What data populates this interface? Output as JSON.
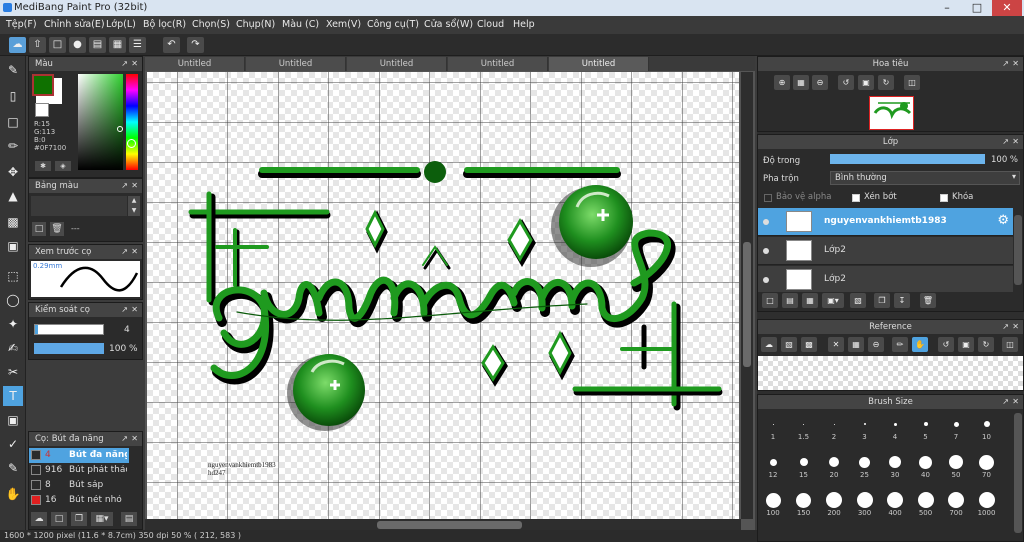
{
  "app": {
    "title": "MediBang Paint Pro (32bit)"
  },
  "menu": [
    "Tệp(F)",
    "Chỉnh sửa(E)",
    "Lớp(L)",
    "Bộ lọc(R)",
    "Chọn(S)",
    "Chụp(N)",
    "Màu (C)",
    "Xem(V)",
    "Công cụ(T)",
    "Cửa sổ(W)",
    "Cloud",
    "Help"
  ],
  "color_panel": {
    "title": "Màu",
    "r": "R:15",
    "g": "G:113",
    "b": "B:0",
    "hex": "#0F7100",
    "fg": "#0f7100",
    "bg": "#ffffff"
  },
  "palette_panel": {
    "title": "Bảng màu",
    "value": "---"
  },
  "preview_panel": {
    "title": "Xem trước cọ",
    "size": "0.29mm"
  },
  "control_panel": {
    "title": "Kiểm soát cọ",
    "size": "4",
    "opacity": "100 %"
  },
  "brush_panel": {
    "title": "Cọ: Bút đa năng",
    "items": [
      {
        "num": "4",
        "name": "Bút đa năng",
        "color": "#2b2b2b",
        "active": true
      },
      {
        "num": "916",
        "name": "Bút phát thảo",
        "color": "#2b2b2b",
        "active": false
      },
      {
        "num": "8",
        "name": "Bút sáp",
        "color": "#2b2b2b",
        "active": false
      },
      {
        "num": "16",
        "name": "Bút nét nhỏ",
        "color": "#e02020",
        "active": false
      }
    ]
  },
  "tabs": [
    "Untitled",
    "Untitled",
    "Untitled",
    "Untitled",
    "Untitled"
  ],
  "canvas": {
    "sig1": "nguyenvankhiemtb1983",
    "sig2": "hd247"
  },
  "status": "1600 * 1200 pixel  (11.6 * 8.7cm)  350 dpi  50 %  ( 212, 583 )",
  "navigator": {
    "title": "Hoa tiêu"
  },
  "layer_panel": {
    "title": "Lớp",
    "opacity_label": "Độ trong",
    "opacity_value": "100 %",
    "blend_label": "Pha trộn",
    "blend_value": "Bình thường",
    "protect_alpha": "Bảo vệ alpha",
    "clipping": "Xén bớt",
    "lock": "Khóa",
    "layers": [
      {
        "name": "nguyenvankhiemtb1983",
        "active": true
      },
      {
        "name": "Lớp2",
        "active": false
      },
      {
        "name": "Lớp2",
        "active": false
      }
    ]
  },
  "reference_panel": {
    "title": "Reference"
  },
  "brush_size_panel": {
    "title": "Brush Size",
    "rows": [
      [
        "1",
        "1.5",
        "2",
        "3",
        "4",
        "5",
        "7",
        "10"
      ],
      [
        "12",
        "15",
        "20",
        "25",
        "30",
        "40",
        "50",
        "70"
      ],
      [
        "100",
        "150",
        "200",
        "300",
        "400",
        "500",
        "700",
        "1000"
      ]
    ]
  },
  "colors": {
    "accent": "#4fa3e0",
    "ink": "#1f9a1f"
  }
}
